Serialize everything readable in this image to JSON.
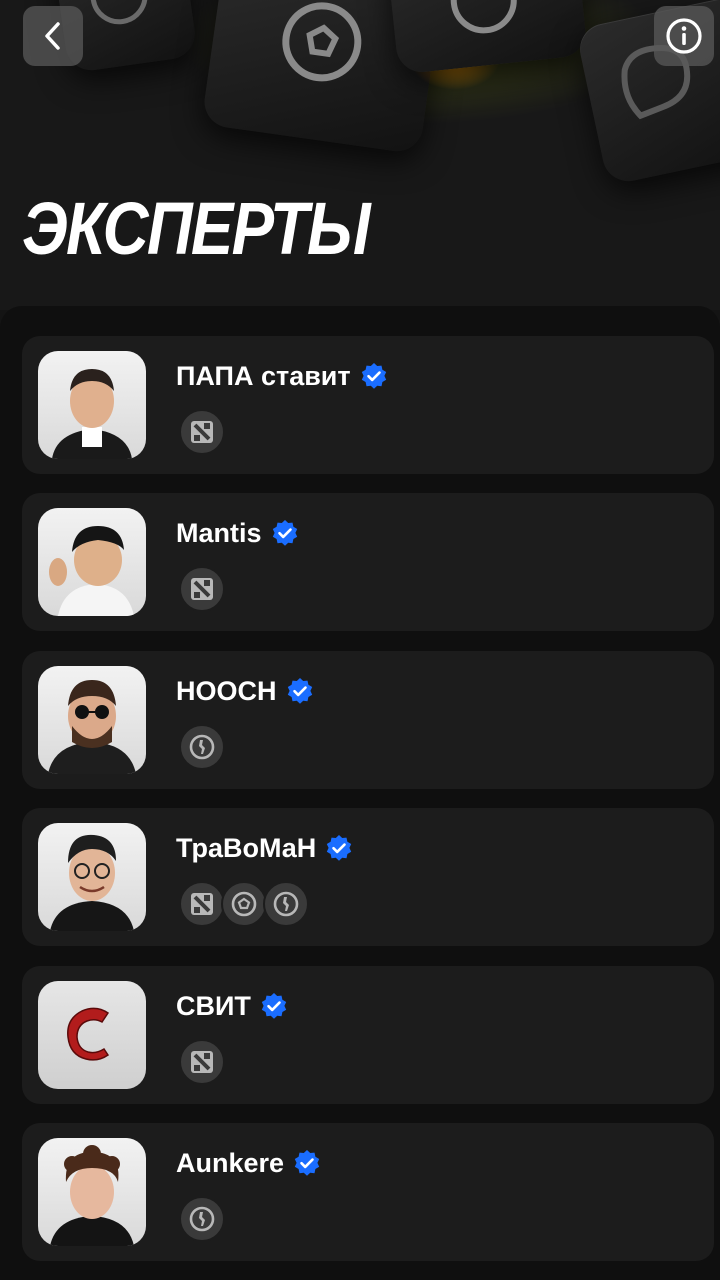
{
  "header": {
    "title": "ЭКСПЕРТЫ",
    "back_icon": "chevron-left-icon",
    "info_icon": "info-circle-icon"
  },
  "colors": {
    "background": "#141414",
    "card": "#1c1c1c",
    "verified": "#1a6dff",
    "glow": "#ff9a00"
  },
  "experts": [
    {
      "name": "ПАПА ставит",
      "verified": true,
      "games": [
        "dota2-icon"
      ]
    },
    {
      "name": "Mantis",
      "verified": true,
      "games": [
        "dota2-icon"
      ]
    },
    {
      "name": "HOOCH",
      "verified": true,
      "games": [
        "counter-strike-icon"
      ]
    },
    {
      "name": "ТраВоМаН",
      "verified": true,
      "games": [
        "dota2-icon",
        "football-icon",
        "counter-strike-icon"
      ]
    },
    {
      "name": "СВИТ",
      "verified": true,
      "games": [
        "dota2-icon"
      ]
    },
    {
      "name": "Aunkere",
      "verified": true,
      "games": [
        "counter-strike-icon"
      ]
    }
  ]
}
